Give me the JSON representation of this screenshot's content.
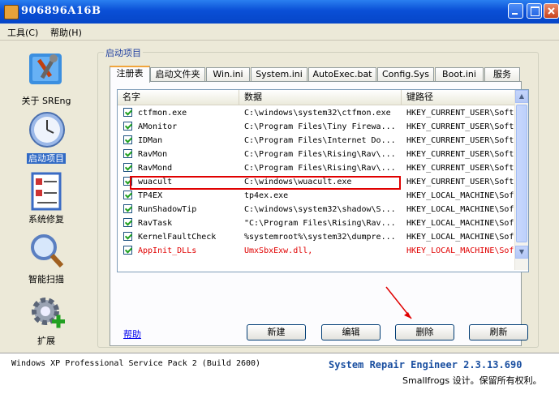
{
  "window": {
    "title": "906896A16B"
  },
  "menu": [
    {
      "label": "工具(C)"
    },
    {
      "label": "帮助(H)"
    }
  ],
  "sidebar": {
    "items": [
      {
        "label": "关于 SREng",
        "icon": "tools-icon",
        "active": false
      },
      {
        "label": "启动项目",
        "icon": "clock-icon",
        "active": true
      },
      {
        "label": "系统修复",
        "icon": "checklist-icon",
        "active": false
      },
      {
        "label": "智能扫描",
        "icon": "magnifier-icon",
        "active": false
      },
      {
        "label": "扩展",
        "icon": "gear-plus-icon",
        "active": false
      }
    ]
  },
  "group": {
    "title": "启动项目"
  },
  "tabs": [
    {
      "label": "注册表",
      "selected": true
    },
    {
      "label": "启动文件夹",
      "selected": false
    },
    {
      "label": "Win.ini",
      "selected": false
    },
    {
      "label": "System.ini",
      "selected": false
    },
    {
      "label": "AutoExec.bat",
      "selected": false
    },
    {
      "label": "Config.Sys",
      "selected": false
    },
    {
      "label": "Boot.ini",
      "selected": false
    },
    {
      "label": "服务",
      "selected": false
    }
  ],
  "list": {
    "columns": [
      "名字",
      "数据",
      "键路径"
    ],
    "rows": [
      {
        "name": "ctfmon.exe",
        "data": "C:\\windows\\system32\\ctfmon.exe",
        "path": "HKEY_CURRENT_USER\\Soft",
        "checked": true,
        "red": false
      },
      {
        "name": "AMonitor",
        "data": "C:\\Program Files\\Tiny Firewa...",
        "path": "HKEY_CURRENT_USER\\Soft",
        "checked": true,
        "red": false
      },
      {
        "name": "IDMan",
        "data": "C:\\Program Files\\Internet Do...",
        "path": "HKEY_CURRENT_USER\\Soft",
        "checked": true,
        "red": false
      },
      {
        "name": "RavMon",
        "data": "C:\\Program Files\\Rising\\Rav\\...",
        "path": "HKEY_CURRENT_USER\\Soft",
        "checked": true,
        "red": false
      },
      {
        "name": "RavMond",
        "data": "C:\\Program Files\\Rising\\Rav\\...",
        "path": "HKEY_CURRENT_USER\\Soft",
        "checked": true,
        "red": false
      },
      {
        "name": "wuacult",
        "data": "C:\\windows\\wuacult.exe",
        "path": "HKEY_CURRENT_USER\\Soft",
        "checked": true,
        "red": false
      },
      {
        "name": "TP4EX",
        "data": "tp4ex.exe",
        "path": "HKEY_LOCAL_MACHINE\\Sof",
        "checked": true,
        "red": false
      },
      {
        "name": "RunShadowTip",
        "data": "C:\\windows\\system32\\shadow\\S...",
        "path": "HKEY_LOCAL_MACHINE\\Sof",
        "checked": true,
        "red": false
      },
      {
        "name": "RavTask",
        "data": "\"C:\\Program Files\\Rising\\Rav...",
        "path": "HKEY_LOCAL_MACHINE\\Sof",
        "checked": true,
        "red": false
      },
      {
        "name": "KernelFaultCheck",
        "data": "%systemroot%\\system32\\dumpre...",
        "path": "HKEY_LOCAL_MACHINE\\Sof",
        "checked": true,
        "red": false
      },
      {
        "name": "AppInit_DLLs",
        "data": "UmxSbxExw.dll,",
        "path": "HKEY_LOCAL_MACHINE\\Sof",
        "checked": true,
        "red": true
      }
    ]
  },
  "actions": {
    "help": "帮助",
    "new": "新建",
    "edit": "编辑",
    "delete": "删除",
    "refresh": "刷新"
  },
  "status": {
    "os": "Windows XP Professional Service Pack 2 (Build 2600)",
    "brand": "System Repair Engineer 2.3.13.690",
    "copyright": "Smallfrogs 设计。保留所有权利。"
  }
}
